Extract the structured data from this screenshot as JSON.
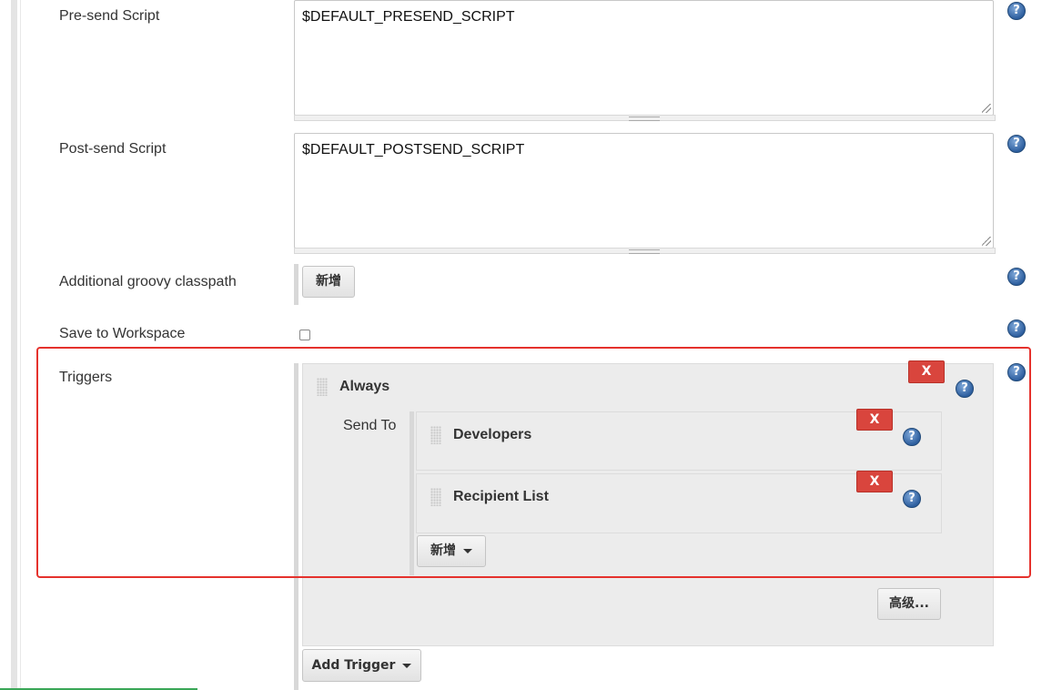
{
  "fields": {
    "presend_label": "Pre-send Script",
    "presend_value": "$DEFAULT_PRESEND_SCRIPT",
    "postsend_label": "Post-send Script",
    "postsend_value": "$DEFAULT_POSTSEND_SCRIPT",
    "classpath_label": "Additional groovy classpath",
    "classpath_add_button": "新增",
    "save_workspace_label": "Save to Workspace",
    "save_workspace_checked": false,
    "triggers_label": "Triggers"
  },
  "trigger": {
    "name": "Always",
    "delete_label": "X",
    "send_to_label": "Send To",
    "recipients": [
      {
        "name": "Developers",
        "delete_label": "X"
      },
      {
        "name": "Recipient List",
        "delete_label": "X"
      }
    ],
    "add_recipient_button": "新增",
    "advanced_button": "高级...",
    "add_trigger_button": "Add Trigger"
  },
  "icons": {
    "help": "?",
    "help_icon": "help-circle-icon",
    "drag_icon": "drag-handle-icon",
    "dropdown_icon": "caret-down-icon"
  },
  "colors": {
    "delete_button": "#d9453d",
    "help_icon": "#2e5f9f",
    "highlight_box": "#e5322d"
  }
}
